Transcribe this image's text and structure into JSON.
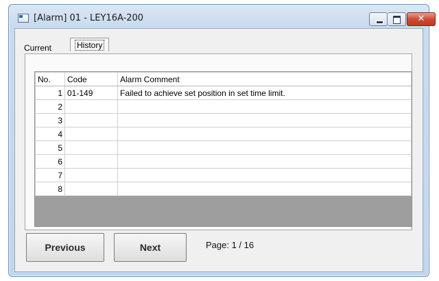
{
  "window": {
    "title": "[Alarm] 01 - LEY16A-200",
    "close_glyph": "✕"
  },
  "tabs": [
    {
      "label": "Current",
      "selected": false
    },
    {
      "label": "History",
      "selected": true
    }
  ],
  "table": {
    "columns": [
      "No.",
      "Code",
      "Alarm Comment"
    ],
    "rows": [
      {
        "no": "1",
        "code": "01-149",
        "comment": "Failed to achieve set position in set time limit."
      },
      {
        "no": "2",
        "code": "",
        "comment": ""
      },
      {
        "no": "3",
        "code": "",
        "comment": ""
      },
      {
        "no": "4",
        "code": "",
        "comment": ""
      },
      {
        "no": "5",
        "code": "",
        "comment": ""
      },
      {
        "no": "6",
        "code": "",
        "comment": ""
      },
      {
        "no": "7",
        "code": "",
        "comment": ""
      },
      {
        "no": "8",
        "code": "",
        "comment": ""
      }
    ]
  },
  "footer": {
    "previous_label": "Previous",
    "next_label": "Next",
    "page_text": "Page: 1 / 16"
  },
  "icons": {
    "app": "window-app-icon",
    "minimize": "minimize-icon",
    "maximize": "maximize-icon",
    "close": "close-icon"
  },
  "colors": {
    "title_bar": "#c9dbef",
    "close_button": "#cf4a33",
    "grid_empty_area": "#9e9e9e"
  }
}
